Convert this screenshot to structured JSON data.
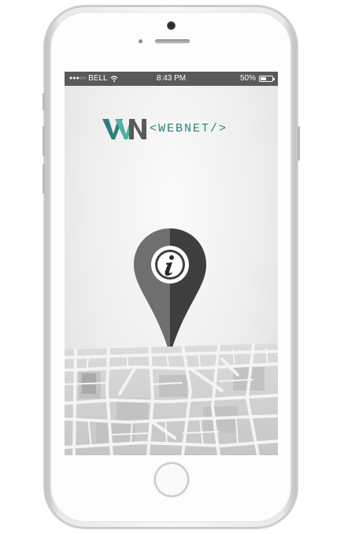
{
  "status_bar": {
    "carrier": "BELL",
    "signal_dots": "●●●○○",
    "time": "8:43 PM",
    "battery_percent": "50%",
    "battery_level": 0.5
  },
  "brand": {
    "text": "<WEBNET/>",
    "colors": {
      "primary": "#2f7f7a",
      "secondary": "#4fb3a5",
      "dark": "#5a5a5a"
    }
  },
  "icons": {
    "pin": "location-pin-icon",
    "info": "info-icon",
    "wifi": "wifi-icon",
    "battery": "battery-icon",
    "map": "street-map-icon"
  },
  "colors": {
    "status_bar_bg": "#5a5a5a",
    "pin_light": "#6f6f6f",
    "pin_dark": "#3e3e3e",
    "map_block": "#c9c9c9",
    "map_street": "#f4f4f4"
  }
}
